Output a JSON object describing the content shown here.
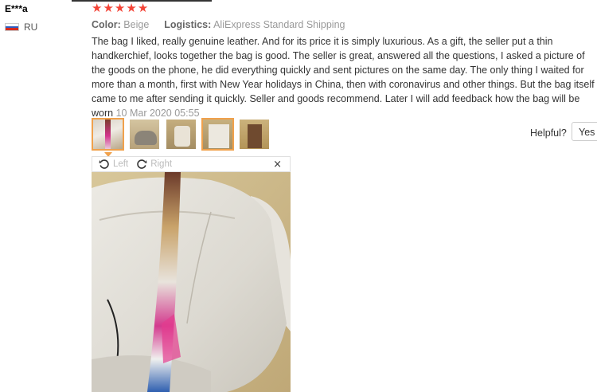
{
  "user": {
    "name": "E***a",
    "country": "RU"
  },
  "rating": {
    "stars": 5
  },
  "meta": {
    "color_label": "Color:",
    "color_value": "Beige",
    "logistics_label": "Logistics:",
    "logistics_value": "AliExpress Standard Shipping"
  },
  "review": {
    "text": "The bag I liked, really genuine leather. And for its price it is simply luxurious. As a gift, the seller put a thin handkerchief, looks together the bag is good. The seller is great, answered all the questions, I asked a picture of the goods on the phone, he did everything quickly and sent pictures on the same day. The only thing I waited for more than a month, first with New Year holidays in China, then with coronavirus and other things. But the bag itself came to me after sending it quickly. Seller and goods recommend. Later I will add feedback how the bag will be worn",
    "date": "10 Mar 2020 05:55"
  },
  "viewer": {
    "rotate_left": "Left",
    "rotate_right": "Right",
    "close": "×"
  },
  "helpful": {
    "label": "Helpful?",
    "yes": "Yes"
  },
  "colors": {
    "star": "#f44336",
    "selected_border": "#f0a14c"
  }
}
